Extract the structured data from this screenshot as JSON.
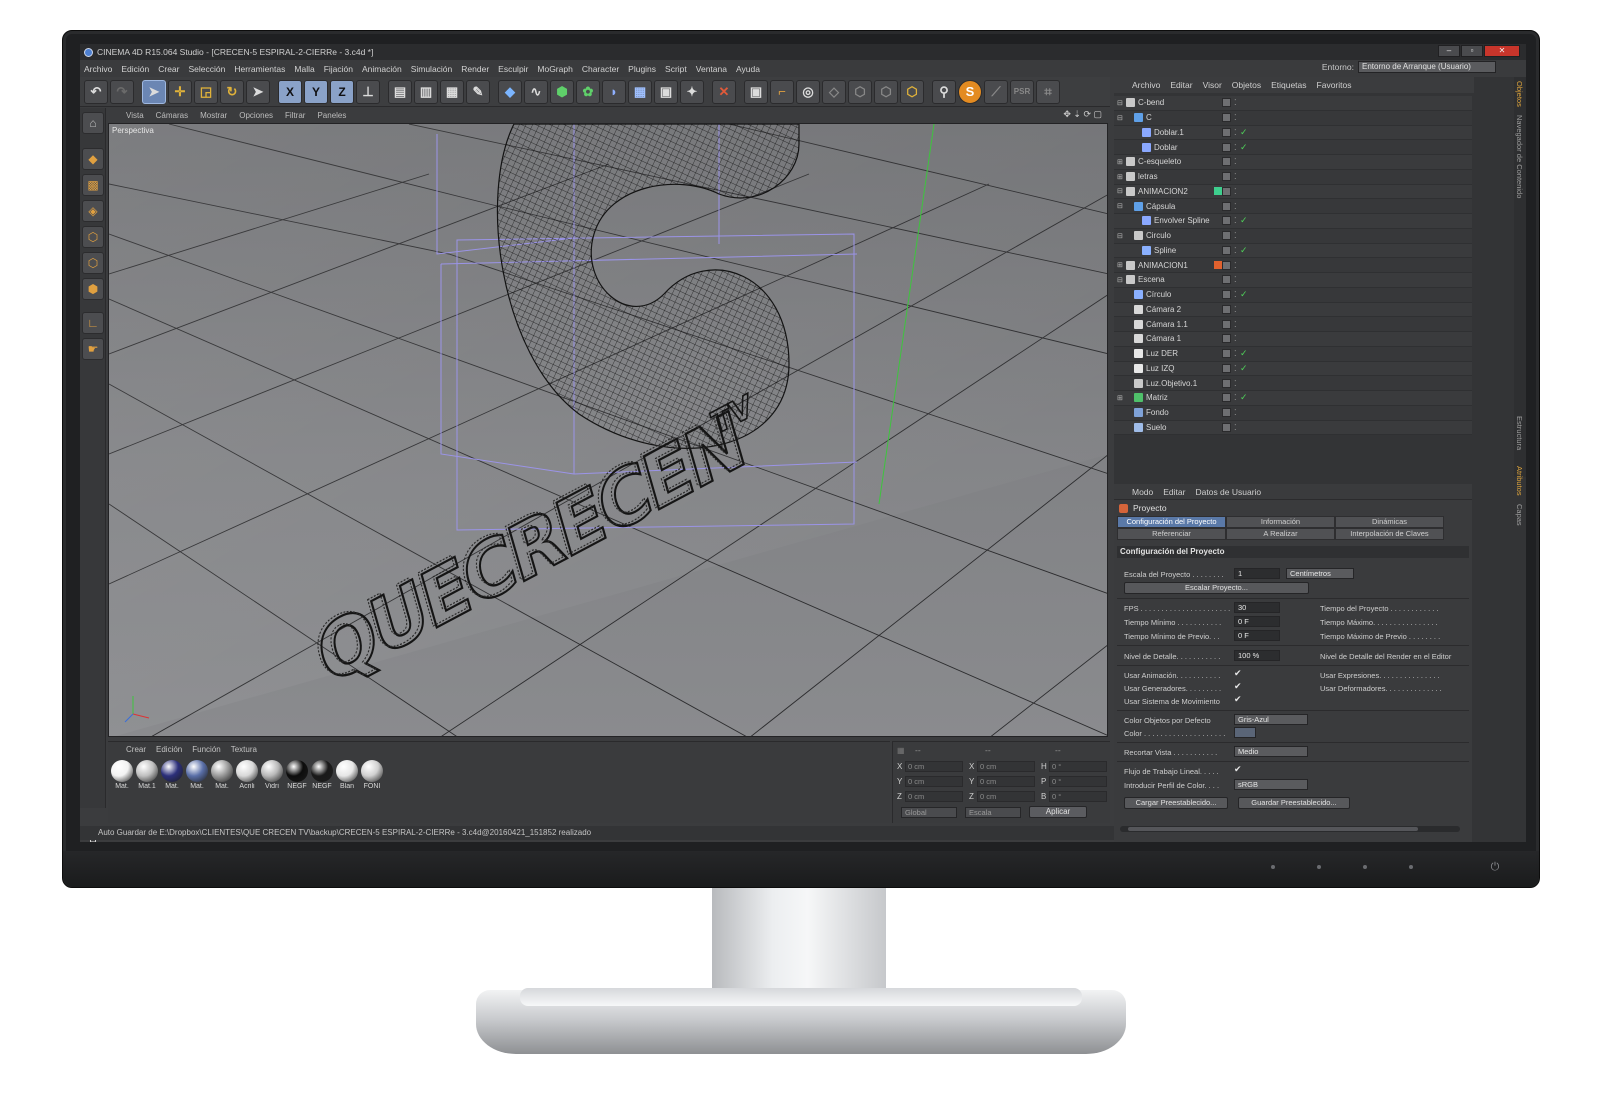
{
  "window": {
    "title": "CINEMA 4D R15.064 Studio - [CRECEN-5 ESPIRAL-2-CIERRe - 3.c4d *]"
  },
  "menubar": {
    "items": [
      "Archivo",
      "Edición",
      "Crear",
      "Selección",
      "Herramientas",
      "Malla",
      "Fijación",
      "Animación",
      "Simulación",
      "Render",
      "Esculpir",
      "MoGraph",
      "Character",
      "Plugins",
      "Script",
      "Ventana",
      "Ayuda"
    ]
  },
  "environment": {
    "label": "Entorno:",
    "value": "Entorno de Arranque (Usuario)"
  },
  "viewport": {
    "menu": [
      "Vista",
      "Cámaras",
      "Mostrar",
      "Opciones",
      "Filtrar",
      "Paneles"
    ],
    "label": "Perspectiva",
    "text3d": "QUECRECENTV"
  },
  "materials": {
    "menu": [
      "Crear",
      "Edición",
      "Función",
      "Textura"
    ],
    "items": [
      {
        "name": "Mat.",
        "color": "#f2f2f2"
      },
      {
        "name": "Mat.1",
        "color": "#bfbfbf"
      },
      {
        "name": "Mat.",
        "color": "#2c2f7a"
      },
      {
        "name": "Mat.",
        "color": "#5a6fa8"
      },
      {
        "name": "Mat.",
        "color": "#9a9a9a"
      },
      {
        "name": "Acrili",
        "color": "#d8d8d8"
      },
      {
        "name": "Vidri",
        "color": "#b8b8b8"
      },
      {
        "name": "NEGF",
        "color": "#0c0c0c"
      },
      {
        "name": "NEGF",
        "color": "#1a1a1a"
      },
      {
        "name": "Blan",
        "color": "#e6e6e6"
      },
      {
        "name": "FONI",
        "color": "#d0d0d0"
      }
    ]
  },
  "coords": {
    "header": [
      "--",
      "--",
      "--"
    ],
    "rows": [
      {
        "a": "X",
        "av": "0 cm",
        "b": "X",
        "bv": "0 cm",
        "c": "H",
        "cv": "0 °"
      },
      {
        "a": "Y",
        "av": "0 cm",
        "b": "Y",
        "bv": "0 cm",
        "c": "P",
        "cv": "0 °"
      },
      {
        "a": "Z",
        "av": "0 cm",
        "b": "Z",
        "bv": "0 cm",
        "c": "B",
        "cv": "0 °"
      }
    ],
    "mode": "Global",
    "scale": "Escala",
    "apply": "Aplicar"
  },
  "status": "Auto Guardar de E:\\Dropbox\\CLIENTES\\QUE CRECEN TV\\backup\\CRECEN-5 ESPIRAL-2-CIERRe - 3.c4d@20160421_151852 realizado",
  "objects": {
    "menu": [
      "Archivo",
      "Editar",
      "Visor",
      "Objetos",
      "Etiquetas",
      "Favoritos"
    ],
    "side_tabs": [
      "Objetos",
      "Navegador de Contenido",
      "Estructura"
    ],
    "rows": [
      {
        "name": "C-bend",
        "indent": 0,
        "exp": "-",
        "icon": "null",
        "check": false,
        "layer": ""
      },
      {
        "name": "C",
        "indent": 1,
        "exp": "-",
        "icon": "gen",
        "check": false,
        "layer": ""
      },
      {
        "name": "Doblar.1",
        "indent": 2,
        "exp": "",
        "icon": "deform",
        "check": true,
        "layer": ""
      },
      {
        "name": "Doblar",
        "indent": 2,
        "exp": "",
        "icon": "deform",
        "check": true,
        "layer": ""
      },
      {
        "name": "C-esqueleto",
        "indent": 0,
        "exp": "+",
        "icon": "null",
        "check": false,
        "layer": ""
      },
      {
        "name": "letras",
        "indent": 0,
        "exp": "+",
        "icon": "null",
        "check": false,
        "layer": ""
      },
      {
        "name": "ANIMACION2",
        "indent": 0,
        "exp": "-",
        "icon": "null",
        "check": false,
        "layer": "#3ecf8e"
      },
      {
        "name": "Cápsula",
        "indent": 1,
        "exp": "-",
        "icon": "gen",
        "check": false,
        "layer": ""
      },
      {
        "name": "Envolver Spline",
        "indent": 2,
        "exp": "",
        "icon": "deform",
        "check": true,
        "layer": ""
      },
      {
        "name": "Circulo",
        "indent": 1,
        "exp": "-",
        "icon": "null",
        "check": false,
        "layer": ""
      },
      {
        "name": "Spline",
        "indent": 2,
        "exp": "",
        "icon": "spline",
        "check": true,
        "layer": ""
      },
      {
        "name": "ANIMACION1",
        "indent": 0,
        "exp": "+",
        "icon": "null",
        "check": false,
        "layer": "#e0612e"
      },
      {
        "name": "Escena",
        "indent": 0,
        "exp": "-",
        "icon": "null",
        "check": false,
        "layer": ""
      },
      {
        "name": "Círculo",
        "indent": 1,
        "exp": "",
        "icon": "spline",
        "check": true,
        "layer": ""
      },
      {
        "name": "Cámara 2",
        "indent": 1,
        "exp": "",
        "icon": "camera",
        "check": false,
        "layer": ""
      },
      {
        "name": "Cámara 1.1",
        "indent": 1,
        "exp": "",
        "icon": "camera",
        "check": false,
        "layer": ""
      },
      {
        "name": "Cámara 1",
        "indent": 1,
        "exp": "",
        "icon": "camera",
        "check": false,
        "layer": ""
      },
      {
        "name": "Luz DER",
        "indent": 1,
        "exp": "",
        "icon": "light",
        "check": true,
        "layer": ""
      },
      {
        "name": "Luz IZQ",
        "indent": 1,
        "exp": "",
        "icon": "light",
        "check": true,
        "layer": ""
      },
      {
        "name": "Luz.Objetivo.1",
        "indent": 1,
        "exp": "",
        "icon": "null",
        "check": false,
        "layer": ""
      },
      {
        "name": "Matriz",
        "indent": 1,
        "exp": "+",
        "icon": "mograph",
        "check": true,
        "layer": ""
      },
      {
        "name": "Fondo",
        "indent": 1,
        "exp": "",
        "icon": "bg",
        "check": false,
        "layer": ""
      },
      {
        "name": "Suelo",
        "indent": 1,
        "exp": "",
        "icon": "floor",
        "check": false,
        "layer": ""
      }
    ]
  },
  "attributes": {
    "menu": [
      "Modo",
      "Editar",
      "Datos de Usuario"
    ],
    "side_tabs": [
      "Atributos",
      "Capas"
    ],
    "title": "Proyecto",
    "tabs": [
      "Configuración del Proyecto",
      "Información",
      "Dinámicas",
      "Referenciar",
      "A Realizar",
      "Interpolación de Claves"
    ],
    "section": "Configuración del Proyecto",
    "scale_label": "Escala del Proyecto . . . . . . . .",
    "scale_value": "1",
    "scale_unit": "Centímetros",
    "scale_button": "Escalar Proyecto...",
    "fps_label": "FPS . . . . . . . . . . . . . . . . . . . . . .",
    "fps_value": "30",
    "min_time_label": "Tiempo Mínimo . . . . . . . . . . .",
    "min_time_value": "0 F",
    "min_preview_label": "Tiempo Mínimo de Previo. . .",
    "min_preview_value": "0 F",
    "project_time_label": "Tiempo del Proyecto . . . . . . . . . . . .",
    "max_time_label": "Tiempo Máximo. . . . . . . . . . . . . . . .",
    "max_preview_label": "Tiempo Máximo de Previo . . . . . . . .",
    "detail_label": "Nivel de Detalle. . . . . . . . . . .",
    "detail_value": "100 %",
    "render_detail_label": "Nivel de Detalle del Render en el Editor",
    "use_anim_label": "Usar Animación. . . . . . . . . . .",
    "use_gen_label": "Usar Generadores. . . . . . . . .",
    "use_motion_label": "Usar Sistema de Movimiento",
    "use_expr_label": "Usar Expresiones. . . . . . . . . . . . . . .",
    "use_deform_label": "Usar Deformadores. . . . . . . . . . . . . .",
    "def_color_label": "Color Objetos por Defecto",
    "def_color_value": "Gris-Azul",
    "color_label": "Color . . . . . . . . . . . . . . . . . . . .",
    "clip_label": "Recortar Vista . . . . . . . . . . .",
    "clip_value": "Medio",
    "linear_label": "Flujo de Trabajo Lineal. . . . .",
    "profile_label": "Introducir Perfil de Color. . . .",
    "profile_value": "sRGB",
    "load_preset": "Cargar Preestablecido...",
    "save_preset": "Guardar Preestablecido..."
  }
}
